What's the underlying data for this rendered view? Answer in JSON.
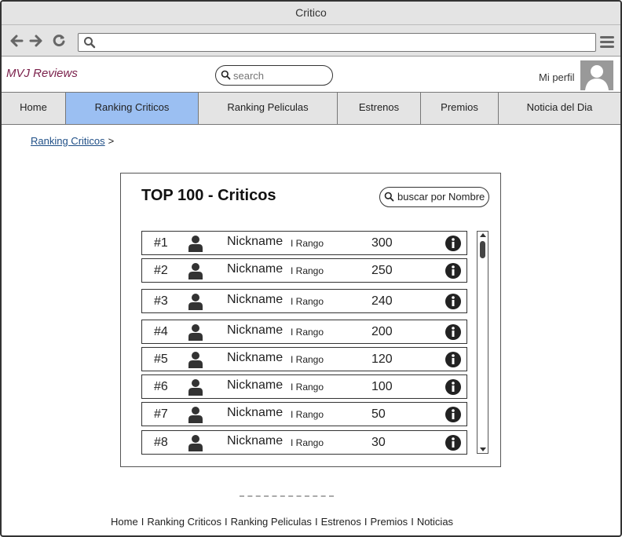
{
  "window": {
    "title": "Critico"
  },
  "browser": {
    "back_icon": "arrow-left-icon",
    "forward_icon": "arrow-right-icon",
    "reload_icon": "reload-icon",
    "address_value": "",
    "menu_icon": "hamburger-menu-icon"
  },
  "header": {
    "brand": "MVJ Reviews",
    "brand_color": "#7a1f4a",
    "search_placeholder": "search",
    "profile_label": "Mi perfil"
  },
  "nav": {
    "active_color": "#9bbff2",
    "tabs": [
      {
        "label": "Home",
        "active": false
      },
      {
        "label": "Ranking Criticos",
        "active": true
      },
      {
        "label": "Ranking Peliculas",
        "active": false
      },
      {
        "label": "Estrenos",
        "active": false
      },
      {
        "label": "Premios",
        "active": false
      },
      {
        "label": "Noticia del Dia",
        "active": false
      }
    ]
  },
  "breadcrumb": {
    "link": "Ranking Criticos",
    "separator": ">"
  },
  "ranking": {
    "title": "TOP 100 - Criticos",
    "search_label": "buscar por Nombre",
    "rows": [
      {
        "rank": "#1",
        "nickname": "Nickname",
        "rango": "I Rango",
        "score": "300"
      },
      {
        "rank": "#2",
        "nickname": "Nickname",
        "rango": "I Rango",
        "score": "250"
      },
      {
        "rank": "#3",
        "nickname": "Nickname",
        "rango": "I Rango",
        "score": "240"
      },
      {
        "rank": "#4",
        "nickname": "Nickname",
        "rango": "I Rango",
        "score": "200"
      },
      {
        "rank": "#5",
        "nickname": "Nickname",
        "rango": "I Rango",
        "score": "120"
      },
      {
        "rank": "#6",
        "nickname": "Nickname",
        "rango": "I Rango",
        "score": "100"
      },
      {
        "rank": "#7",
        "nickname": "Nickname",
        "rango": "I Rango",
        "score": "50"
      },
      {
        "rank": "#8",
        "nickname": "Nickname",
        "rango": "I Rango",
        "score": "30"
      }
    ]
  },
  "footer": {
    "links": [
      "Home",
      "Ranking Criticos",
      "Ranking Peliculas",
      "Estrenos",
      "Premios",
      "Noticias"
    ],
    "separator": "I"
  }
}
